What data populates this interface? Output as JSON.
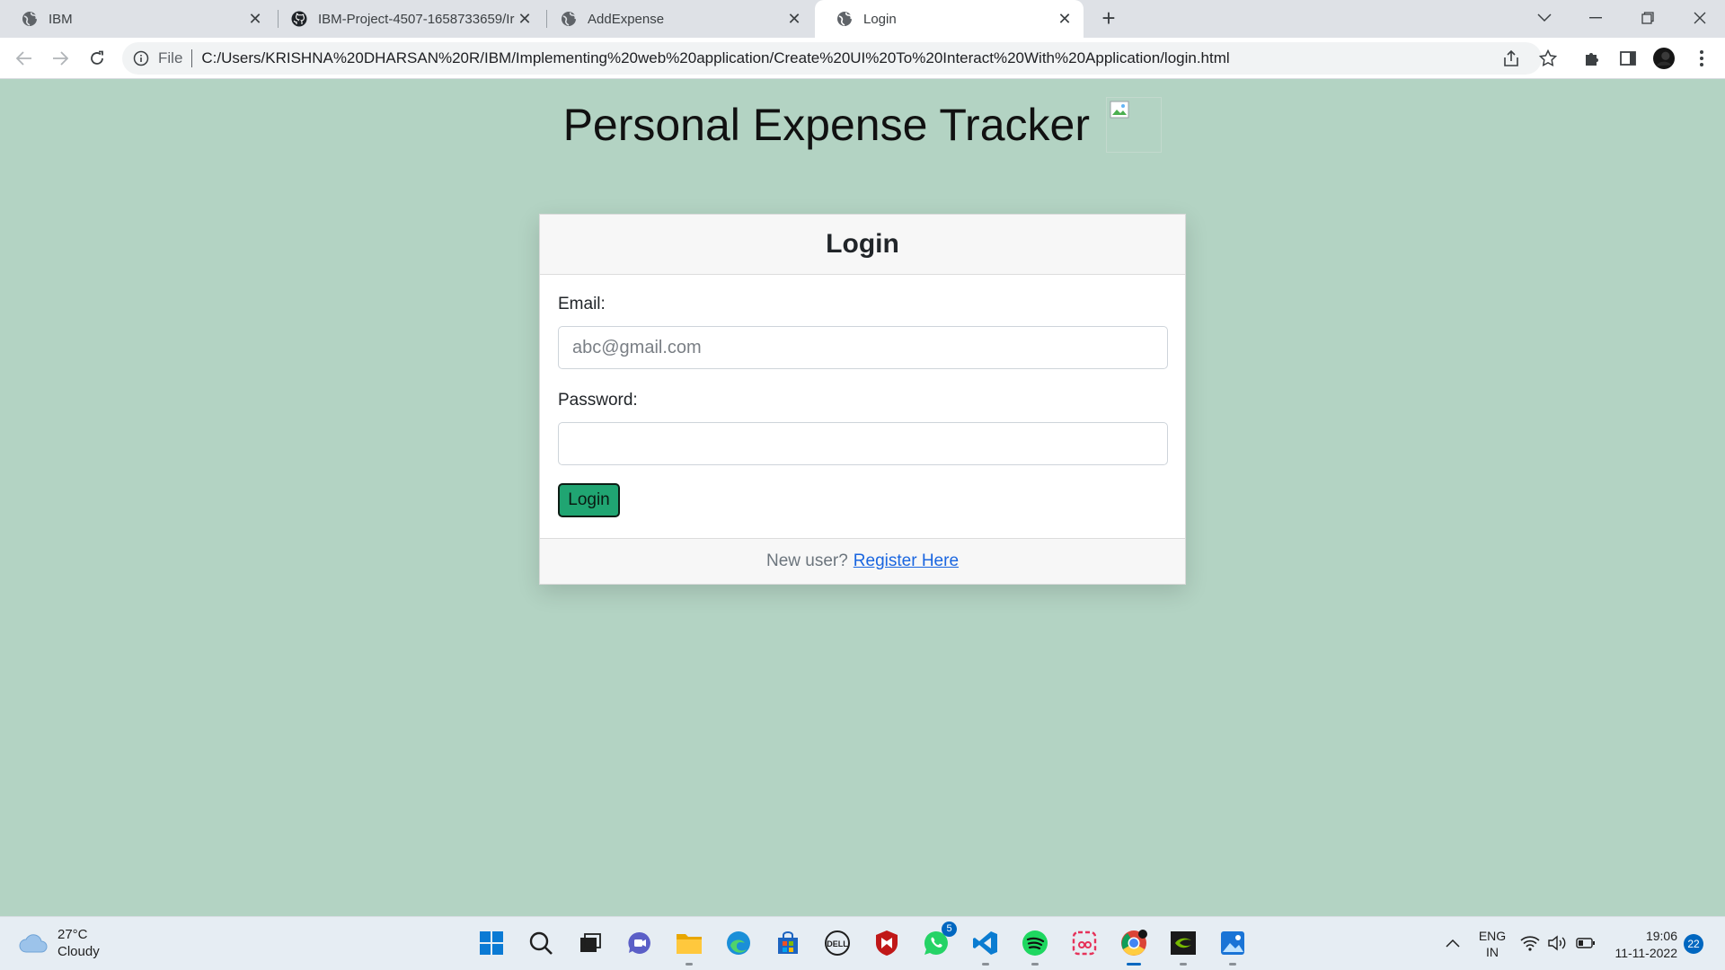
{
  "browser": {
    "tabs": [
      {
        "title": "IBM",
        "icon": "globe-icon",
        "active": false
      },
      {
        "title": "IBM-Project-4507-1658733659/Ir",
        "icon": "github-icon",
        "active": false
      },
      {
        "title": "AddExpense",
        "icon": "globe-icon",
        "active": false
      },
      {
        "title": "Login",
        "icon": "globe-icon",
        "active": true
      }
    ],
    "file_label": "File",
    "url": "C:/Users/KRISHNA%20DHARSAN%20R/IBM/Implementing%20web%20application/Create%20UI%20To%20Interact%20With%20Application/login.html"
  },
  "page": {
    "title": "Personal Expense Tracker",
    "card": {
      "title": "Login",
      "email_label": "Email:",
      "email_placeholder": "abc@gmail.com",
      "email_value": "",
      "password_label": "Password:",
      "password_value": "",
      "login_button": "Login",
      "footer_text": "New user?",
      "register_link": "Register Here"
    },
    "colors": {
      "background": "#b3d3c3",
      "button": "#20a572",
      "link": "#1a66e0"
    }
  },
  "taskbar": {
    "weather": {
      "temp": "27°C",
      "condition": "Cloudy"
    },
    "apps": [
      "windows-start-icon",
      "search-icon",
      "task-view-icon",
      "teams-chat-icon",
      "file-explorer-icon",
      "edge-icon",
      "microsoft-store-icon",
      "dell-icon",
      "mcafee-icon",
      "whatsapp-icon",
      "vscode-icon",
      "spotify-icon",
      "snipping-tool-icon",
      "chrome-icon",
      "nvidia-icon",
      "photos-icon"
    ],
    "whatsapp_badge": "5",
    "language": {
      "line1": "ENG",
      "line2": "IN"
    },
    "clock": {
      "time": "19:06",
      "date": "11-11-2022"
    },
    "notifications": "22"
  }
}
